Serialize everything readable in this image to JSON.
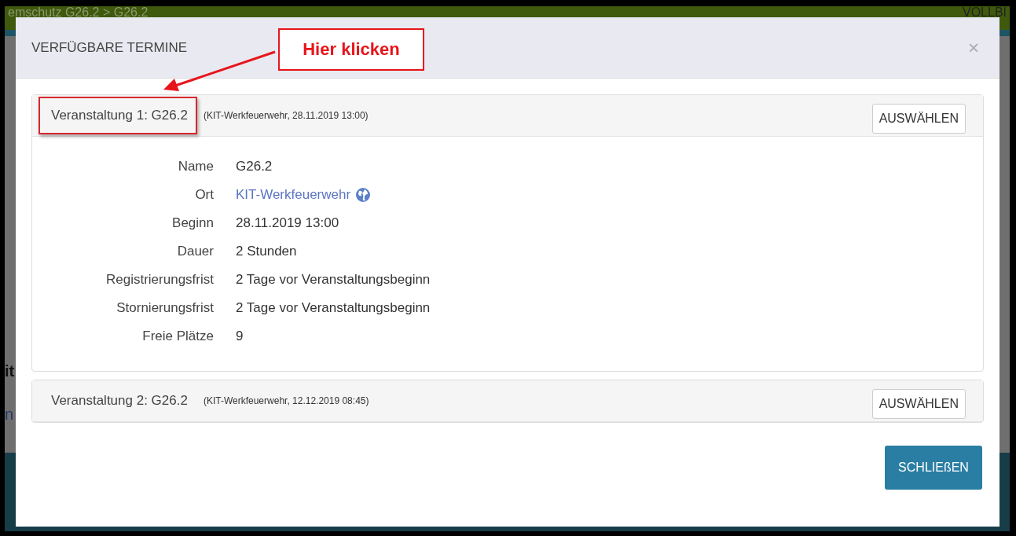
{
  "background": {
    "breadcrumb": "emschutz G26.2 > G26.2",
    "right_text": "VOLLBI",
    "fragments": [
      "it",
      "n"
    ]
  },
  "modal": {
    "title": "VERFÜGBARE TERMINE",
    "close": "×",
    "footer_button": "SCHLIEßEN"
  },
  "events": [
    {
      "title": "Veranstaltung 1: G26.2",
      "subtitle": "(KIT-Werkfeuerwehr, 28.11.2019 13:00)",
      "button": "AUSWÄHLEN",
      "expanded": true,
      "highlighted": true,
      "details": [
        {
          "label": "Name",
          "value": "G26.2",
          "kind": "text"
        },
        {
          "label": "Ort",
          "value": "KIT-Werkfeuerwehr",
          "kind": "link"
        },
        {
          "label": "Beginn",
          "value": "28.11.2019 13:00",
          "kind": "text"
        },
        {
          "label": "Dauer",
          "value": "2 Stunden",
          "kind": "text"
        },
        {
          "label": "Registrierungsfrist",
          "value": "2 Tage vor Veranstaltungsbeginn",
          "kind": "text"
        },
        {
          "label": "Stornierungsfrist",
          "value": "2 Tage vor Veranstaltungsbeginn",
          "kind": "text"
        },
        {
          "label": "Freie Plätze",
          "value": "9",
          "kind": "text"
        }
      ]
    },
    {
      "title": "Veranstaltung 2: G26.2",
      "subtitle": "(KIT-Werkfeuerwehr, 12.12.2019 08:45)",
      "button": "AUSWÄHLEN",
      "expanded": false,
      "highlighted": false
    }
  ],
  "annotation": {
    "label": "Hier klicken"
  }
}
